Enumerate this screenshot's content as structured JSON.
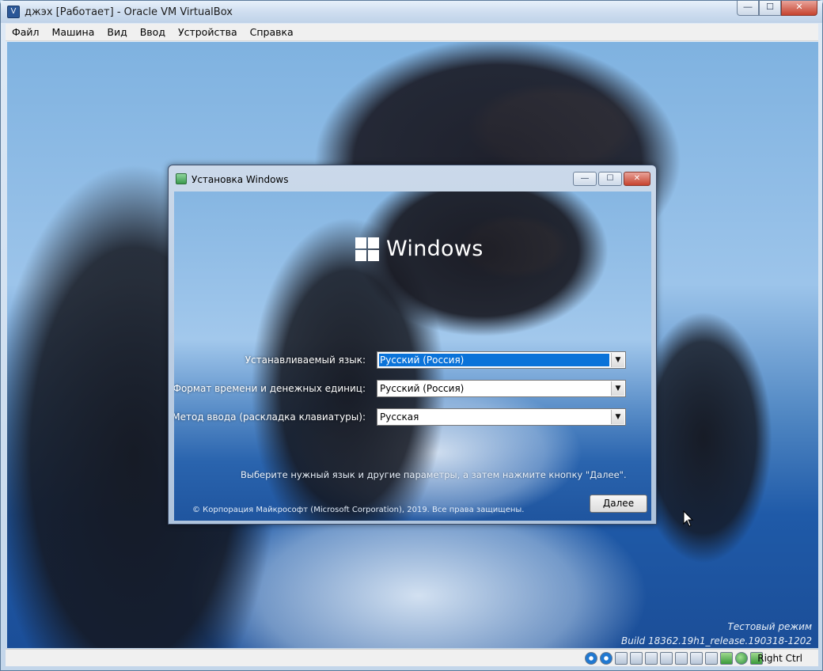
{
  "host_window": {
    "title": "джэх [Работает] - Oracle VM VirtualBox",
    "controls": {
      "minimize": "—",
      "maximize": "☐",
      "close": "✕"
    }
  },
  "menubar": {
    "items": [
      "Файл",
      "Машина",
      "Вид",
      "Ввод",
      "Устройства",
      "Справка"
    ]
  },
  "setup_dialog": {
    "title": "Установка Windows",
    "logo_text": "Windows",
    "fields": [
      {
        "label": "Устанавливаемый язык:",
        "value": "Русский (Россия)"
      },
      {
        "label": "Формат времени и денежных единиц:",
        "value": "Русский (Россия)"
      },
      {
        "label": "Метод ввода (раскладка клавиатуры):",
        "value": "Русская"
      }
    ],
    "hint": "Выберите нужный язык и другие параметры, а затем нажмите кнопку \"Далее\".",
    "copyright": "© Корпорация Майкрософт (Microsoft Corporation), 2019. Все права защищены.",
    "next_label": "Далее",
    "controls": {
      "minimize": "—",
      "maximize": "☐",
      "close": "✕"
    }
  },
  "watermark": {
    "line1": "Тестовый режим",
    "line2": "Build 18362.19h1_release.190318-1202"
  },
  "statusbar": {
    "host_key": "Right Ctrl",
    "icons": [
      "hard-disk-icon",
      "optical-drive-icon",
      "audio-icon",
      "network-icon",
      "usb-icon",
      "shared-folders-icon",
      "display-icon",
      "video-capture-icon",
      "recording-icon",
      "virtualization-icon",
      "mouse-integration-icon",
      "keyboard-icon"
    ]
  }
}
